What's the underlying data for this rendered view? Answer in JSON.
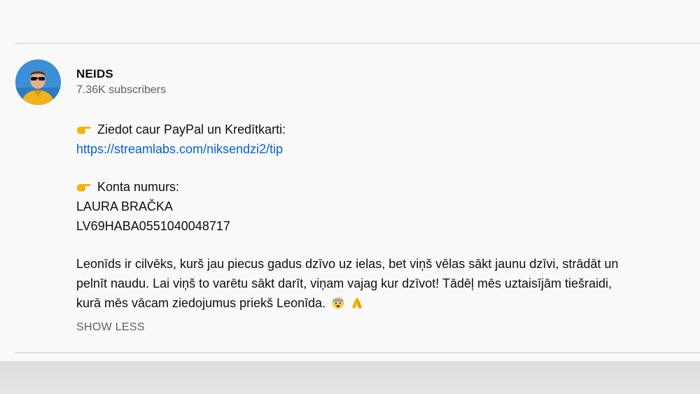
{
  "channel": {
    "name": "NEIDS",
    "subscribers": "7.36K subscribers",
    "avatar_icon": "avatar-photo-icon"
  },
  "description": {
    "donate_label": "Ziedot caur PayPal un Kredītkarti:",
    "donate_link": "https://streamlabs.com/niksendzi2/tip",
    "account_label": "Konta numurs:",
    "account_name": "LAURA BRAČKA",
    "account_number": "LV69HABA0551040048717",
    "paragraph_lines": [
      "Leonīds ir cilvēks, kurš jau piecus gadus dzīvo uz ielas, bet viņš vēlas sākt jaunu dzīvi, strādāt un",
      "pelnīt naudu. Lai viņš to varētu sākt darīt, viņam vajag kur dzīvot! Tādēļ mēs uztaisījām tiešraidi,",
      "kurā mēs vācam ziedojumus priekš Leonīda."
    ],
    "emojis": [
      "anxious-face-icon",
      "folded-hands-icon"
    ]
  },
  "actions": {
    "show_less_label": "SHOW LESS"
  },
  "colors": {
    "link": "#065fd4",
    "secondary_text": "#606060",
    "background": "#f9f9f9"
  }
}
